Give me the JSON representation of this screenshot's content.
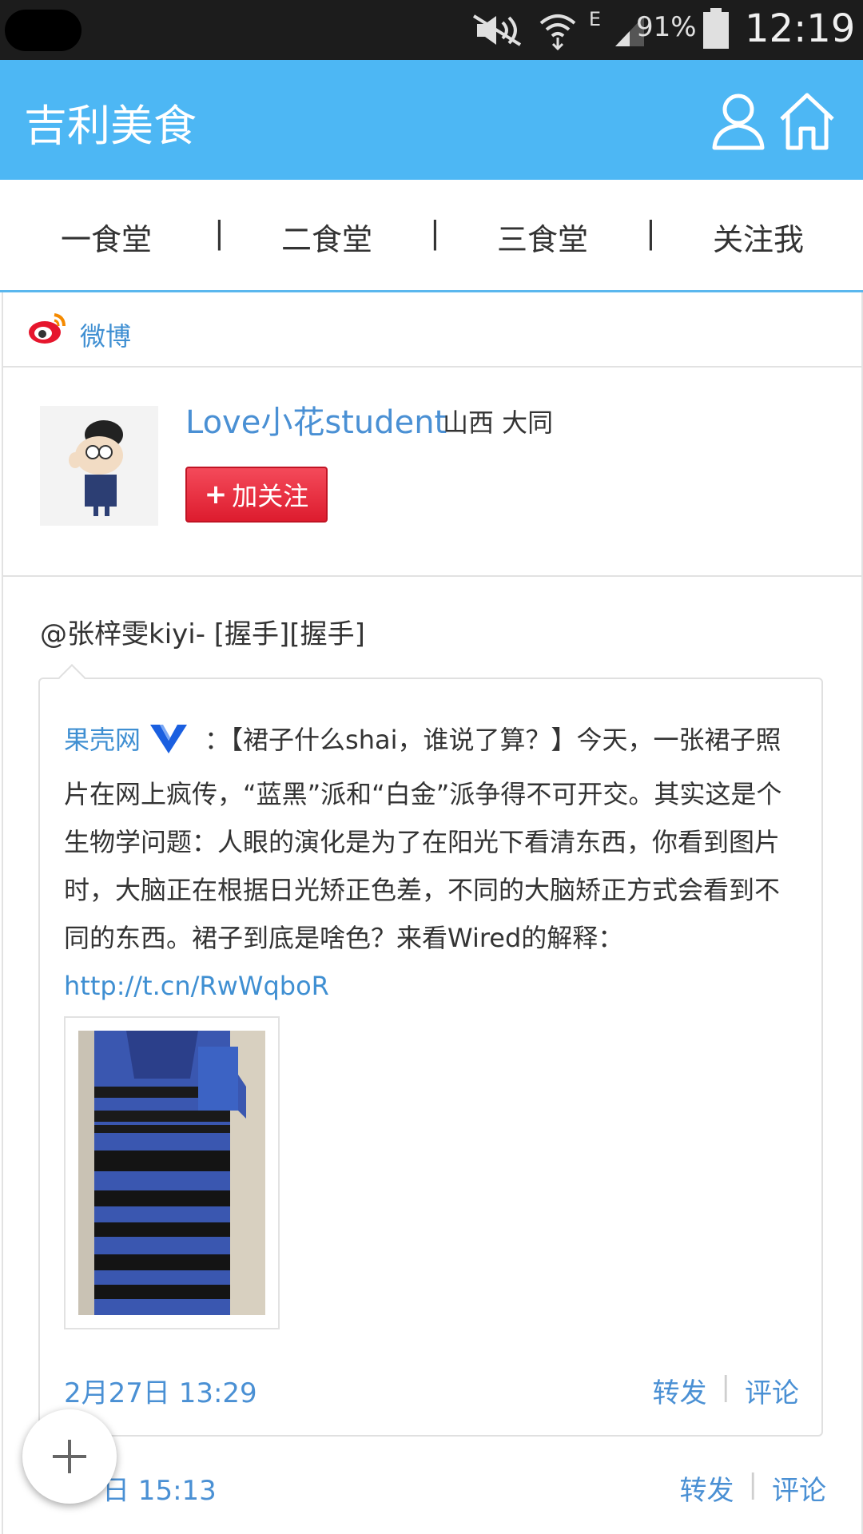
{
  "status_bar": {
    "network": "E",
    "battery_percent": "91%",
    "time": "12:19"
  },
  "app_bar": {
    "title": "吉利美食"
  },
  "tabs": [
    "一食堂",
    "二食堂",
    "三食堂",
    "关注我"
  ],
  "tab_separator": "|",
  "weibo": {
    "label": "微博"
  },
  "profile": {
    "username": "Love小花student",
    "location": "山西 大同",
    "follow_label": "加关注",
    "follow_plus": "+"
  },
  "post": {
    "text": "@张梓雯kiyi- [握手][握手]",
    "time": "2月27日 15:13",
    "time_visible": "日 15:13",
    "repost": "转发",
    "comment": "评论",
    "divider": "|"
  },
  "quoted": {
    "author": "果壳网",
    "colon": "：",
    "body": "【裙子什么shai，谁说了算？】今天，一张裙子照片在网上疯传，“蓝黑”派和“白金”派争得不可开交。其实这是个生物学问题：人眼的演化是为了在阳光下看清东西，你看到图片时，大脑正在根据日光矫正色差，不同的大脑矫正方式会看到不同的东西。裙子到底是啥色？来看Wired的解释：",
    "link": "http://t.cn/RwWqboR",
    "time": "2月27日 13:29",
    "repost": "转发",
    "comment": "评论",
    "divider": "|"
  },
  "colors": {
    "app_bar": "#4db7f4",
    "link": "#3f8fd2",
    "follow_button": "#e8283a"
  },
  "icons": [
    "mute-icon",
    "wifi-icon",
    "signal-icon",
    "battery-icon",
    "user-icon",
    "home-icon",
    "weibo-logo-icon",
    "verified-v-icon",
    "add-icon"
  ]
}
